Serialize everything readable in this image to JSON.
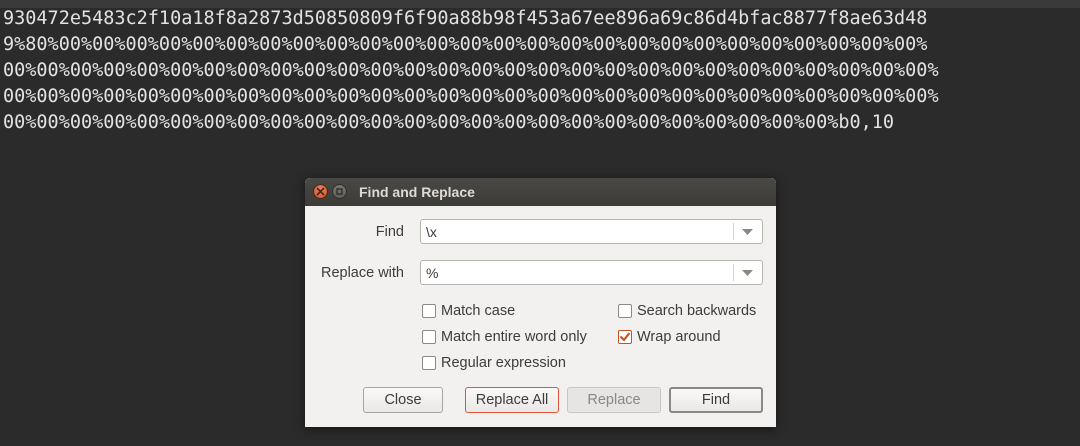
{
  "editor": {
    "lines": [
      "930472e5483c2f10a18f8a2873d50850809f6f90a88b98f453a67ee896a69c86d4bfac8877f8ae63d48",
      "9%80%00%00%00%00%00%00%00%00%00%00%00%00%00%00%00%00%00%00%00%00%00%00%00%00%00%00%",
      "00%00%00%00%00%00%00%00%00%00%00%00%00%00%00%00%00%00%00%00%00%00%00%00%00%00%00%00%",
      "00%00%00%00%00%00%00%00%00%00%00%00%00%00%00%00%00%00%00%00%00%00%00%00%00%00%00%00%",
      "00%00%00%00%00%00%00%00%00%00%00%00%00%00%00%00%00%00%00%00%00%00%00%00%00%b0,10"
    ]
  },
  "dialog": {
    "title": "Find and Replace",
    "find_label": "Find",
    "find_value": "\\x",
    "replace_label": "Replace with",
    "replace_value": "%",
    "options": {
      "match_case": {
        "label": "Match case",
        "checked": false
      },
      "match_entire_word": {
        "label": "Match entire word only",
        "checked": false
      },
      "regular_expression": {
        "label": "Regular expression",
        "checked": false
      },
      "search_backwards": {
        "label": "Search backwards",
        "checked": false
      },
      "wrap_around": {
        "label": "Wrap around",
        "checked": true
      }
    },
    "buttons": {
      "close": "Close",
      "replace_all": "Replace All",
      "replace": "Replace",
      "find": "Find"
    }
  },
  "colors": {
    "editor_bg": "#2b2b2b",
    "editor_text": "#e2e2e2",
    "dialog_bg": "#f2f1f0",
    "titlebar_bg": "#3c3b37",
    "accent": "#e0553d"
  }
}
